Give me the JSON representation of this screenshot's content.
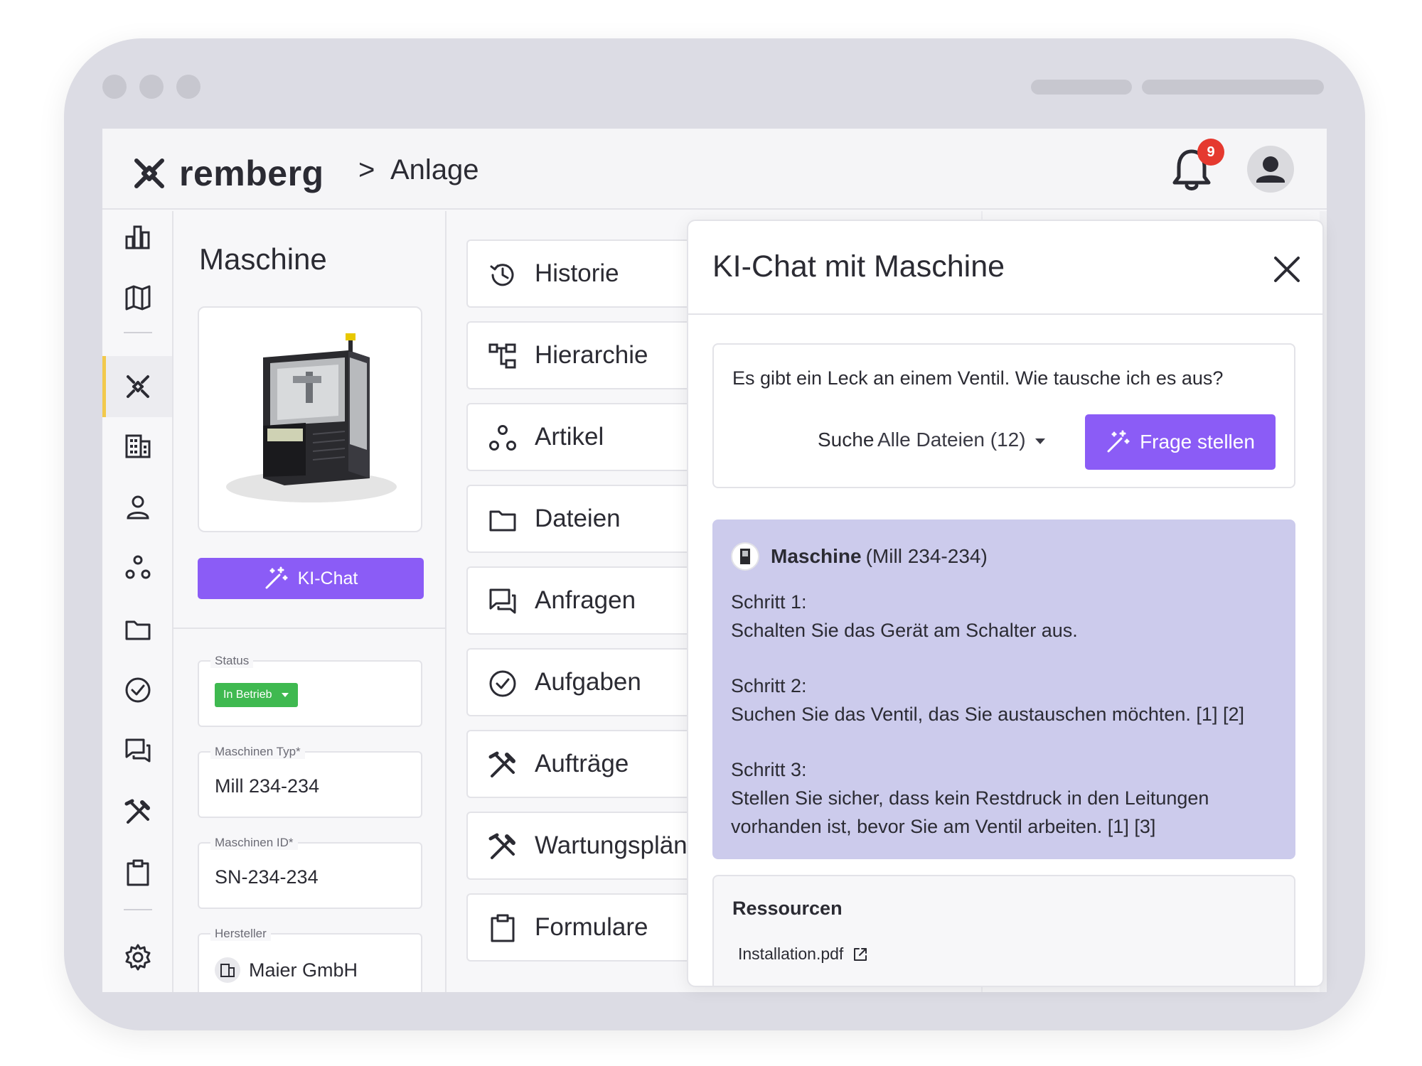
{
  "header": {
    "logo_text": "remberg",
    "breadcrumb_sep": ">",
    "breadcrumb": "Anlage",
    "notification_count": "9"
  },
  "sidebar": {
    "items": [
      {
        "icon": "bar-chart-icon"
      },
      {
        "icon": "map-icon"
      },
      {
        "icon": "machine-icon",
        "active": true
      },
      {
        "icon": "building-icon"
      },
      {
        "icon": "person-icon"
      },
      {
        "icon": "parts-icon"
      },
      {
        "icon": "folder-icon"
      },
      {
        "icon": "check-circle-icon"
      },
      {
        "icon": "chat-icon"
      },
      {
        "icon": "tools-icon"
      },
      {
        "icon": "clipboard-icon"
      },
      {
        "icon": "gear-icon"
      }
    ]
  },
  "machine": {
    "title": "Maschine",
    "kichat_label": "KI-Chat",
    "status_label": "Status",
    "status_value": "In Betrieb",
    "type_label": "Maschinen Typ*",
    "type_value": "Mill 234-234",
    "id_label": "Maschinen ID*",
    "id_value": "SN-234-234",
    "manufacturer_label": "Hersteller",
    "manufacturer_value": "Maier GmbH"
  },
  "menu": {
    "items": [
      {
        "label": "Historie"
      },
      {
        "label": "Hierarchie"
      },
      {
        "label": "Artikel"
      },
      {
        "label": "Dateien"
      },
      {
        "label": "Anfragen"
      },
      {
        "label": "Aufgaben"
      },
      {
        "label": "Aufträge"
      },
      {
        "label": "Wartungspläne"
      },
      {
        "label": "Formulare"
      }
    ]
  },
  "chat": {
    "title": "KI-Chat mit Maschine",
    "question": "Es gibt ein Leck an einem Ventil. Wie tausche ich es aus?",
    "search_label": "Suche",
    "search_value": "Alle Dateien (12)",
    "ask_label": "Frage stellen",
    "answer": {
      "source_name": "Maschine",
      "source_detail": "(Mill 234-234)",
      "steps": [
        {
          "title": "Schritt 1:",
          "text": "Schalten Sie das Gerät am Schalter aus."
        },
        {
          "title": "Schritt 2:",
          "text": "Suchen Sie das Ventil, das Sie austauschen möchten. [1] [2]"
        },
        {
          "title": "Schritt 3:",
          "text": "Stellen Sie sicher, dass kein Restdruck in den Leitungen vorhanden ist, bevor Sie am Ventil arbeiten. [1] [3]"
        }
      ]
    },
    "resources_title": "Ressourcen",
    "resources": [
      {
        "name": "Installation.pdf"
      }
    ]
  },
  "colors": {
    "accent": "#8b5cf6",
    "answer_bg": "#cccbec",
    "status_green": "#3fb950",
    "badge_red": "#e5392f",
    "active_marker": "#f2c94c"
  }
}
